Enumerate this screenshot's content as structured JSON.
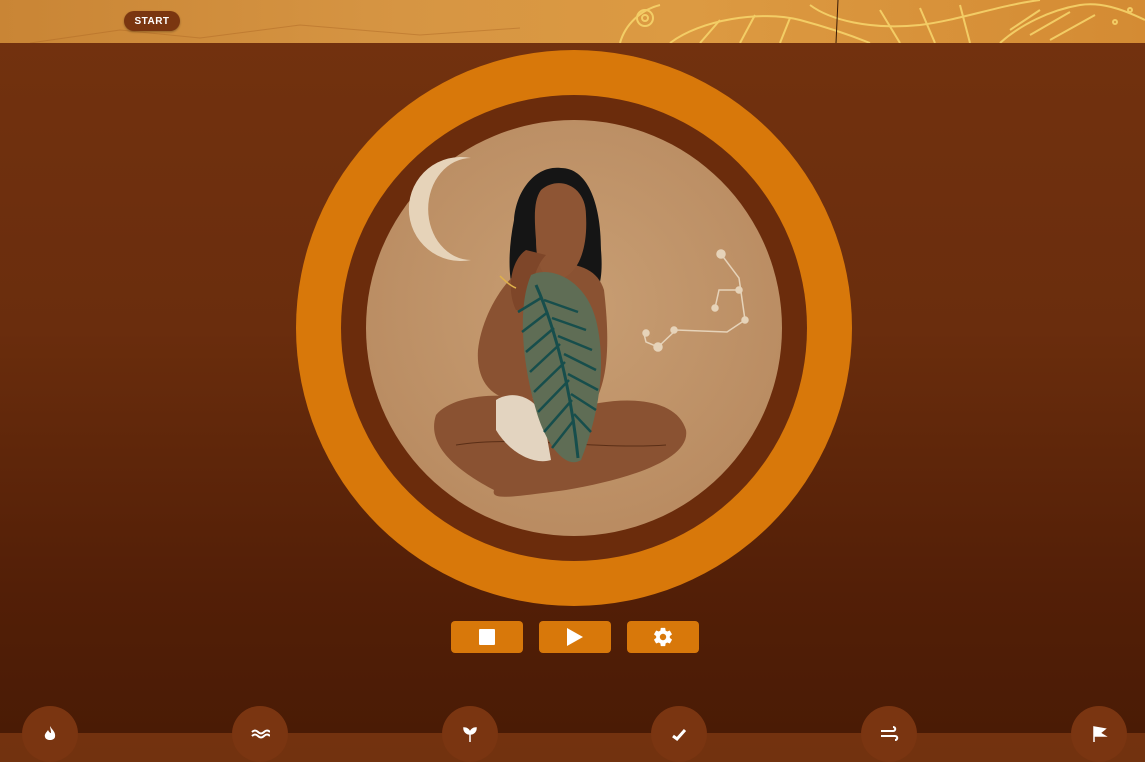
{
  "header": {
    "start_label": "START"
  },
  "illustration": {
    "name": "meditating-woman-with-leaf"
  },
  "controls": [
    {
      "icon": "stop-icon",
      "name": "stop-button"
    },
    {
      "icon": "play-icon",
      "name": "play-button"
    },
    {
      "icon": "gear-icon",
      "name": "settings-button"
    }
  ],
  "bottom_nav": [
    {
      "icon": "fire-icon"
    },
    {
      "icon": "water-icon"
    },
    {
      "icon": "plant-icon"
    },
    {
      "icon": "check-icon"
    },
    {
      "icon": "wind-icon"
    },
    {
      "icon": "flag-icon"
    }
  ],
  "colors": {
    "accent_orange": "#d8780a",
    "ring_inner": "#6b2c0c",
    "background": "#6a2d0d",
    "nav_button": "#7a3511"
  }
}
